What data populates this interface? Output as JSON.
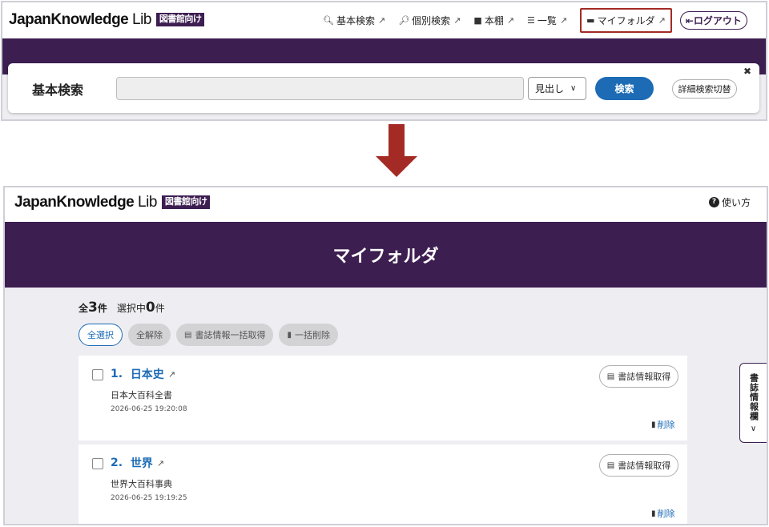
{
  "panel1": {
    "logo": {
      "main": "JapanKnowledge",
      "lib": "Lib",
      "badge": "図書館向け"
    },
    "nav": [
      {
        "icon": "search-icon",
        "label": "基本検索"
      },
      {
        "icon": "search-detail-icon",
        "label": "個別検索"
      },
      {
        "icon": "book-icon",
        "label": "本棚"
      },
      {
        "icon": "list-icon",
        "label": "一覧"
      },
      {
        "icon": "folder-icon",
        "label": "マイフォルダ",
        "highlighted": true
      }
    ],
    "logout_label": "ログアウト",
    "search": {
      "title": "基本検索",
      "input_value": "",
      "select_value": "見出し",
      "search_button": "検索",
      "detail_toggle": "詳細検索切替"
    }
  },
  "panel2": {
    "logo": {
      "main": "JapanKnowledge",
      "lib": "Lib",
      "badge": "図書館向け"
    },
    "help_label": "使い方",
    "page_title": "マイフォルダ",
    "counts": {
      "total_prefix": "全",
      "total": "3",
      "total_suffix": "件",
      "selected_prefix": "選択中",
      "selected": "0",
      "selected_suffix": "件"
    },
    "actions": {
      "select_all": "全選択",
      "deselect_all": "全解除",
      "bulk_bib": "書誌情報一括取得",
      "bulk_delete": "一括削除"
    },
    "items": [
      {
        "number": "1.",
        "title": "日本史",
        "source": "日本大百科全書",
        "date": "2026-06-25 19:20:08",
        "bib_button": "書誌情報取得",
        "delete_label": "削除"
      },
      {
        "number": "2.",
        "title": "世界",
        "source": "世界大百科事典",
        "date": "2026-06-25 19:19:25",
        "bib_button": "書誌情報取得",
        "delete_label": "削除"
      }
    ],
    "side_tab_label": "書誌情報欄"
  },
  "colors": {
    "brand_purple": "#3d1e51",
    "link_blue": "#1d6bb5",
    "highlight_red": "#a42b25"
  }
}
